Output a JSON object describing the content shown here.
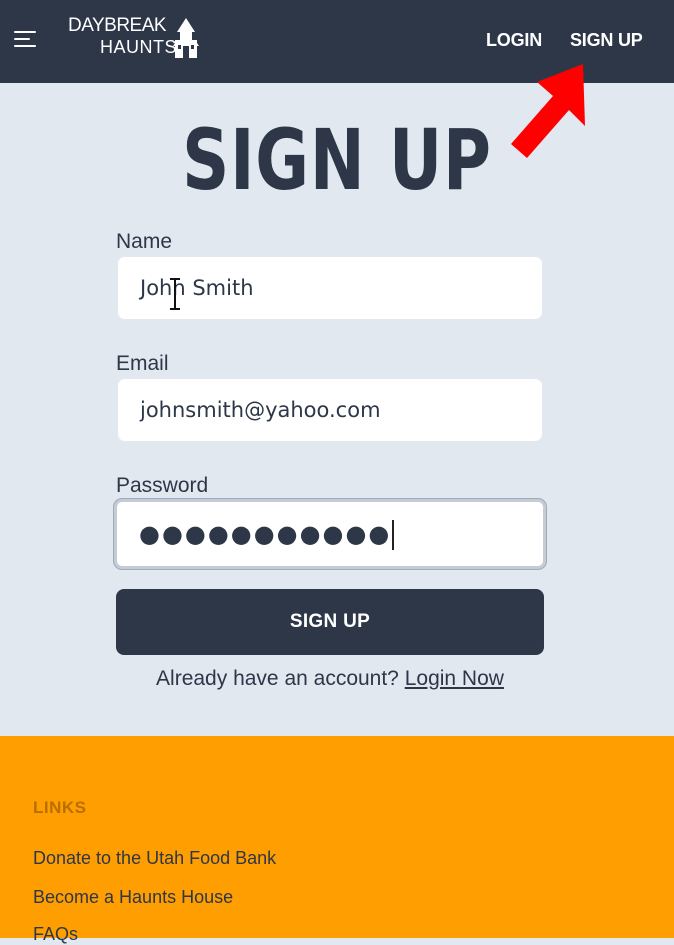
{
  "header": {
    "logo": {
      "line1": "DAYBREAK",
      "line2": "HAUNTS"
    },
    "nav": {
      "login": "LOGIN",
      "signup": "SIGN UP"
    }
  },
  "main": {
    "title": "SIGN UP",
    "form": {
      "name_label": "Name",
      "name_value": "John Smith",
      "email_label": "Email",
      "email_value": "johnsmith@yahoo.com",
      "password_label": "Password",
      "password_masked": "●●●●●●●●●●●",
      "submit_label": "SIGN UP"
    },
    "account_prompt": "Already have an account?",
    "login_link": "Login Now"
  },
  "footer": {
    "heading": "LINKS",
    "links": [
      "Donate to the Utah Food Bank",
      "Become a Haunts House",
      "FAQs"
    ]
  },
  "colors": {
    "header_bg": "#2d3748",
    "page_bg": "#e2e8f0",
    "footer_bg": "#ff9e00",
    "annotation_arrow": "#ff0000"
  },
  "icons": [
    "menu-icon",
    "castle-icon",
    "red-arrow-annotation",
    "text-cursor-icon"
  ]
}
